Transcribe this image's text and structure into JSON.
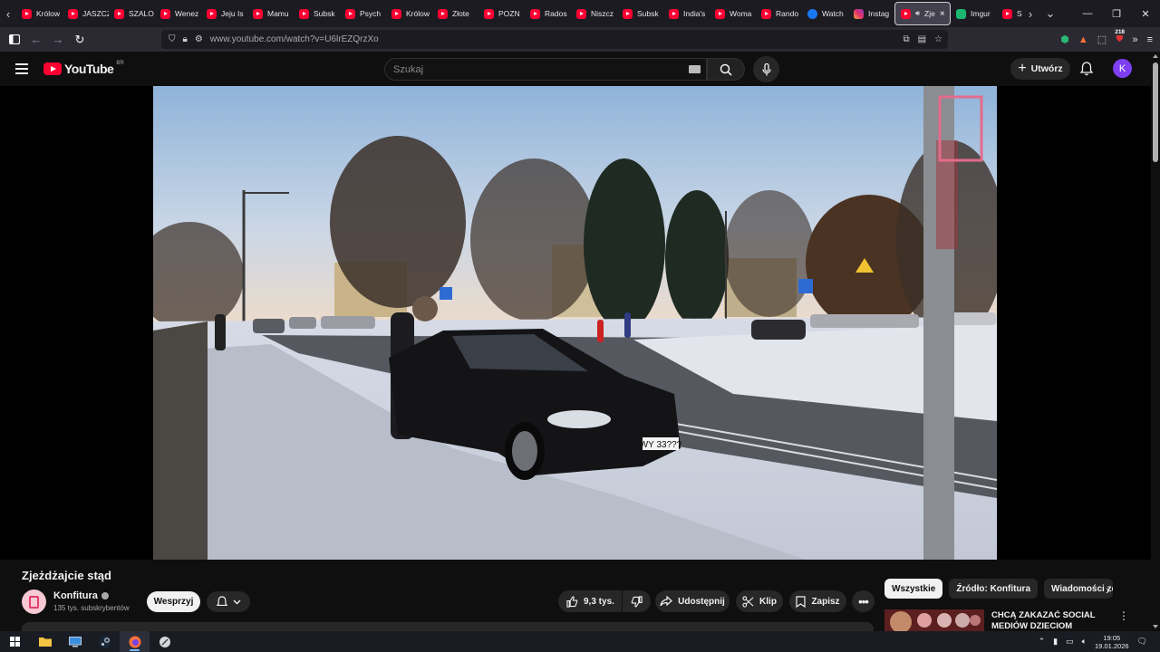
{
  "browser": {
    "tabs": [
      {
        "label": "Królow",
        "icon": "youtube-icon"
      },
      {
        "label": "JASZCZ",
        "icon": "youtube-icon"
      },
      {
        "label": "SZALO",
        "icon": "youtube-icon"
      },
      {
        "label": "Wenez",
        "icon": "youtube-icon"
      },
      {
        "label": "Jeju Is",
        "icon": "youtube-icon"
      },
      {
        "label": "Mamu",
        "icon": "youtube-icon"
      },
      {
        "label": "Subsk",
        "icon": "youtube-icon"
      },
      {
        "label": "Psych",
        "icon": "youtube-icon"
      },
      {
        "label": "Królow",
        "icon": "youtube-icon"
      },
      {
        "label": "Złote",
        "icon": "youtube-icon"
      },
      {
        "label": "POZN",
        "icon": "youtube-icon"
      },
      {
        "label": "Rados",
        "icon": "youtube-icon"
      },
      {
        "label": "Niszcz",
        "icon": "youtube-icon"
      },
      {
        "label": "Subsk",
        "icon": "youtube-icon"
      },
      {
        "label": "India's",
        "icon": "youtube-icon"
      },
      {
        "label": "Woma",
        "icon": "youtube-icon"
      },
      {
        "label": "Rando",
        "icon": "youtube-icon"
      },
      {
        "label": "Watch",
        "icon": "meta-icon"
      },
      {
        "label": "Instag",
        "icon": "instagram-icon"
      },
      {
        "label": "Zje",
        "icon": "youtube-icon",
        "active": true
      },
      {
        "label": "Imgur",
        "icon": "imgur-icon"
      },
      {
        "label": "Seks",
        "icon": "youtube-icon"
      }
    ],
    "url": "www.youtube.com/watch?v=U6lrEZQrzXo",
    "extensions_badge": "218"
  },
  "youtube": {
    "logo_text": "YouTube",
    "country_code": "BR",
    "search_placeholder": "Szukaj",
    "create_label": "Utwórz",
    "avatar_letter": "K"
  },
  "video": {
    "title": "Zjeżdżajcie stąd",
    "plate": "WY 33???",
    "channel": {
      "name": "Konfitura",
      "subscribers": "135 tys. subskrybentów"
    },
    "support_label": "Wesprzyj",
    "actions": {
      "likes": "9,3 tys.",
      "share": "Udostępnij",
      "clip": "Klip",
      "save": "Zapisz"
    }
  },
  "recommendations": {
    "chips": [
      "Wszystkie",
      "Źródło: Konfitura",
      "Wiadomości ze"
    ],
    "first_title": "CHCĄ ZAKAZAĆ SOCIAL MEDIÓW DZIECIOM"
  },
  "taskbar": {
    "time": "19:05",
    "date": "19.01.2026"
  },
  "colors": {
    "youtube_red": "#ff0033",
    "background": "#0f0f0f",
    "avatar_purple": "#7e3ff2"
  }
}
